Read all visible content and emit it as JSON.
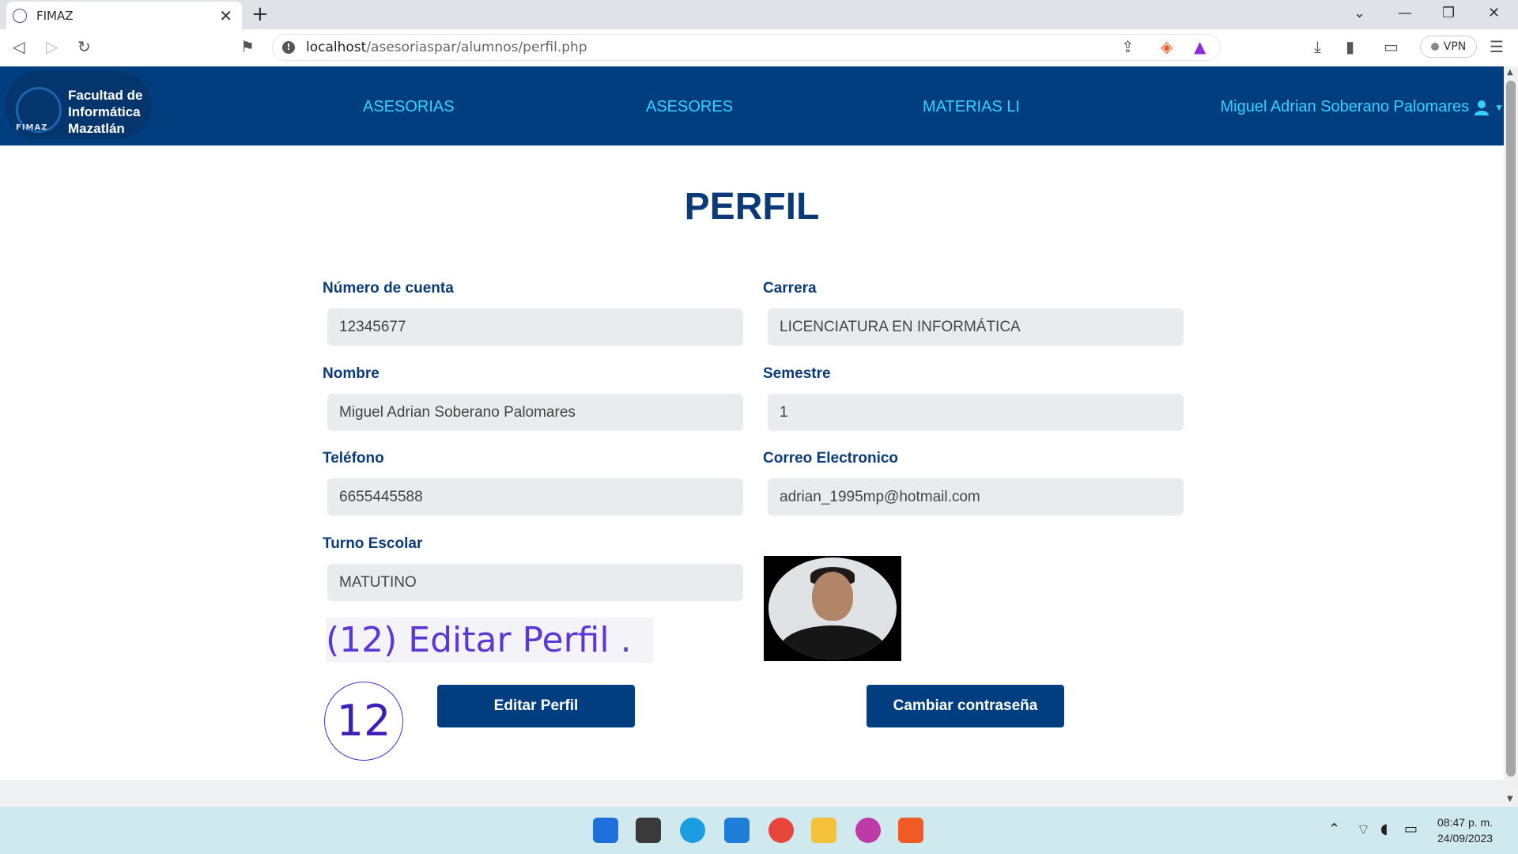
{
  "browser": {
    "tab_title": "FIMAZ",
    "url_host": "localhost",
    "url_path": "/asesoriaspar/alumnos/perfil.php",
    "vpn_label": "VPN"
  },
  "navbar": {
    "logo_lines": [
      "Facultad de",
      "Informática",
      "Mazatlán"
    ],
    "logo_mark": "FIMAZ",
    "links": [
      "ASESORIAS",
      "ASESORES",
      "MATERIAS LI"
    ],
    "user_name": "Miguel Adrian Soberano Palomares"
  },
  "page": {
    "title": "PERFIL",
    "fields": {
      "cuenta": {
        "label": "Número de cuenta",
        "value": "12345677"
      },
      "carrera": {
        "label": "Carrera",
        "value": "LICENCIATURA EN INFORMÁTICA"
      },
      "nombre": {
        "label": "Nombre",
        "value": "Miguel Adrian Soberano Palomares"
      },
      "semestre": {
        "label": "Semestre",
        "value": "1"
      },
      "telefono": {
        "label": "Teléfono",
        "value": "6655445588"
      },
      "correo": {
        "label": "Correo Electronico",
        "value": "adrian_1995mp@hotmail.com"
      },
      "turno": {
        "label": "Turno Escolar",
        "value": "MATUTINO"
      }
    },
    "annotation_text": "(12) Editar Perfil .",
    "annotation_number": "12",
    "buttons": {
      "edit": "Editar Perfil",
      "password": "Cambiar contraseña"
    }
  },
  "taskbar": {
    "time": "08:47 p. m.",
    "date": "24/09/2023"
  }
}
